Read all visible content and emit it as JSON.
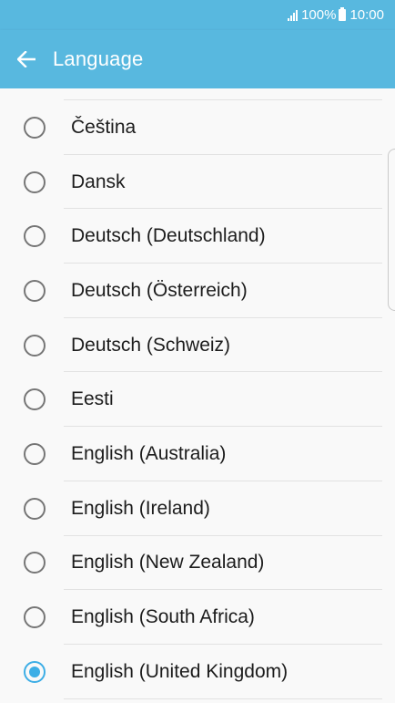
{
  "status_bar": {
    "battery": "100%",
    "time": "10:00",
    "icons": [
      "signal-icon",
      "battery-icon"
    ]
  },
  "app_bar": {
    "title": "Language",
    "back_icon": "arrow-left-icon"
  },
  "languages": [
    {
      "label": "Čeština",
      "selected": false
    },
    {
      "label": "Dansk",
      "selected": false
    },
    {
      "label": "Deutsch (Deutschland)",
      "selected": false
    },
    {
      "label": "Deutsch (Österreich)",
      "selected": false
    },
    {
      "label": "Deutsch (Schweiz)",
      "selected": false
    },
    {
      "label": "Eesti",
      "selected": false
    },
    {
      "label": "English (Australia)",
      "selected": false
    },
    {
      "label": "English (Ireland)",
      "selected": false
    },
    {
      "label": "English (New Zealand)",
      "selected": false
    },
    {
      "label": "English (South Africa)",
      "selected": false
    },
    {
      "label": "English (United Kingdom)",
      "selected": true
    }
  ],
  "colors": {
    "header": "#58b8df",
    "accent": "#3daee6",
    "text": "#1c1c1c",
    "radio_unselected": "#767676"
  }
}
